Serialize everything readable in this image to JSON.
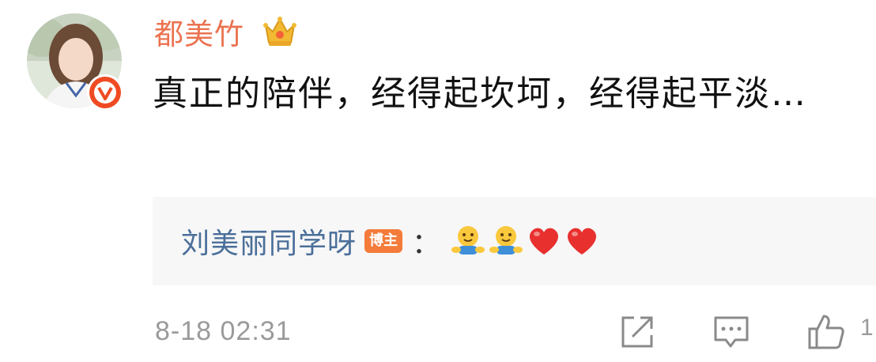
{
  "comment": {
    "username": "都美竹",
    "text": "真正的陪伴，经得起坎坷，经得起平淡…",
    "timestamp": "8-18 02:31",
    "like_count": "1"
  },
  "reply": {
    "username": "刘美丽同学呀",
    "badge": "博主",
    "colon": "：",
    "emojis": [
      "hug-emoji",
      "hug-emoji",
      "heart-emoji",
      "heart-emoji"
    ]
  },
  "colors": {
    "username": "#eb7350",
    "reply_username": "#4b6f9a",
    "badge_bg": "#f47b3a",
    "verified": "#f04a22",
    "heart": "#e8302f",
    "reply_bg": "#f7f7f7"
  },
  "icons": [
    "crown-icon",
    "verified-icon",
    "share-icon",
    "comment-icon",
    "like-icon"
  ]
}
